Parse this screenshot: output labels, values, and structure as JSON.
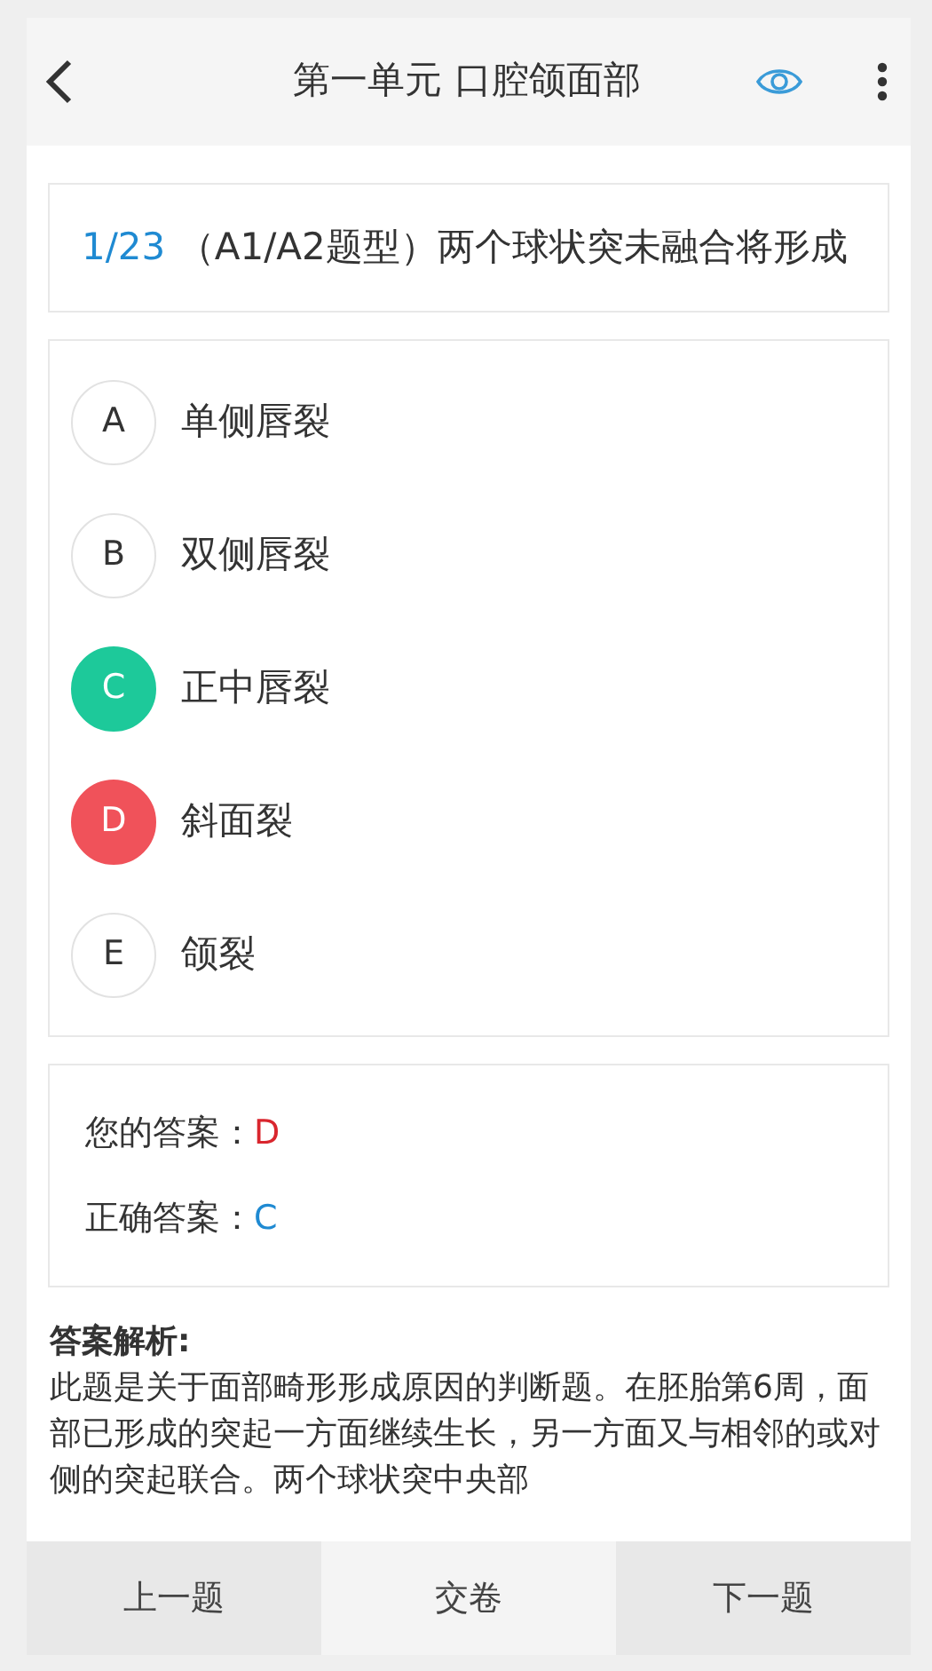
{
  "header": {
    "title": "第一单元 口腔颌面部"
  },
  "question": {
    "number": "1/23",
    "text": "（A1/A2题型）两个球状突未融合将形成"
  },
  "options": [
    {
      "letter": "A",
      "text": "单侧唇裂",
      "selected": false,
      "correct": false
    },
    {
      "letter": "B",
      "text": "双侧唇裂",
      "selected": false,
      "correct": false
    },
    {
      "letter": "C",
      "text": "正中唇裂",
      "selected": false,
      "correct": true
    },
    {
      "letter": "D",
      "text": "斜面裂",
      "selected": true,
      "correct": false
    },
    {
      "letter": "E",
      "text": "颌裂",
      "selected": false,
      "correct": false
    }
  ],
  "answers": [
    {
      "label": "您的答案：",
      "value": "D",
      "correct": false
    },
    {
      "label": "正确答案：",
      "value": "C",
      "correct": true
    }
  ],
  "analysis": {
    "title": "答案解析:",
    "text": "此题是关于面部畸形形成原因的判断题。在胚胎第6周，面部已形成的突起一方面继续生长，另一方面又与相邻的或对侧的突起联合。两个球状突中央部"
  },
  "footer": {
    "buttons": [
      {
        "label": "上一题",
        "kind": "side"
      },
      {
        "label": "交卷",
        "kind": "center"
      },
      {
        "label": "下一题",
        "kind": "side"
      }
    ]
  }
}
